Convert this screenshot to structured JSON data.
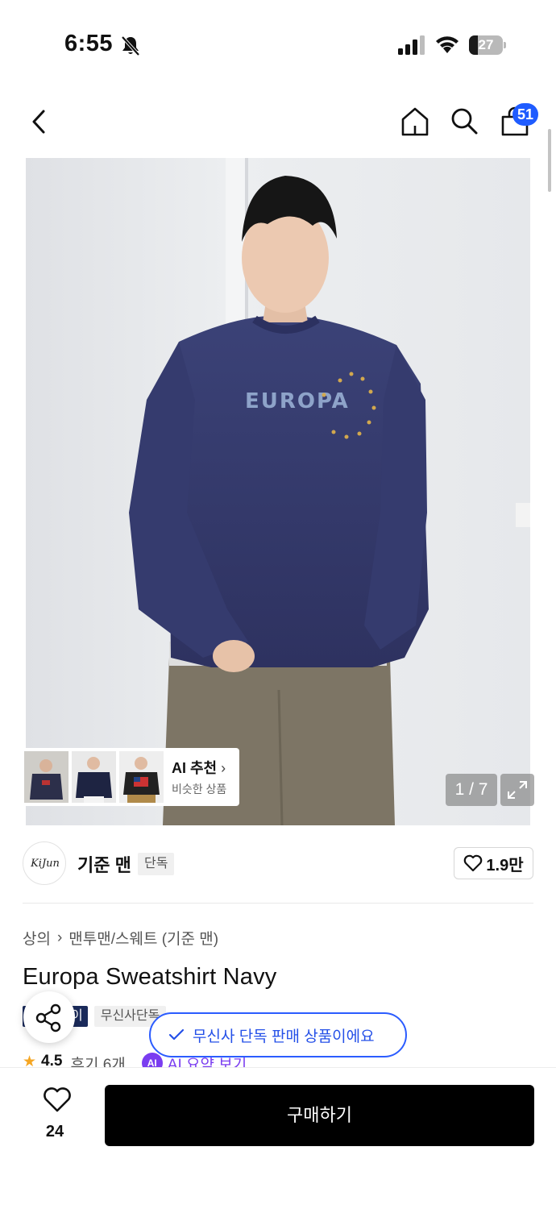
{
  "status_bar": {
    "time": "6:55",
    "battery_level": "27",
    "battery_fraction": 0.27,
    "icons": [
      "bell-slash-icon",
      "signal-icon",
      "wifi-icon",
      "battery-icon"
    ]
  },
  "nav": {
    "icons": [
      "chevron-left-icon",
      "home-icon",
      "search-icon",
      "shopping-bag-icon"
    ],
    "cart_count": "51"
  },
  "gallery": {
    "image_alt": "Model wearing navy EUROPA sweatshirt",
    "print_text": "EUROPA",
    "page_counter": "1 / 7",
    "ai_recommend": {
      "title": "AI 추천",
      "subtitle": "비슷한 상품"
    }
  },
  "brand": {
    "logo_text": "KiJun",
    "name": "기준 맨",
    "tag": "단독",
    "likes": "1.9만"
  },
  "product": {
    "breadcrumb": [
      "상의",
      "맨투맨/스웨트 (기준 맨)"
    ],
    "title": "Europa Sweatshirt Navy",
    "tags": [
      "이",
      "무신사단독"
    ],
    "rating": "4.5",
    "review_text": "후기 6개",
    "ai_badge": "AI",
    "ai_summary": "AI 요약 보기"
  },
  "toast": {
    "text": "무신사 단독 판매 상품이에요"
  },
  "bottom_bar": {
    "wish_count": "24",
    "buy_label": "구매하기"
  },
  "colors": {
    "accent_blue": "#1f5cff",
    "toast_blue": "#2450e8",
    "ai_purple": "#7a3df0",
    "sweatshirt_navy": "#33386a",
    "buy_button": "#000000"
  }
}
